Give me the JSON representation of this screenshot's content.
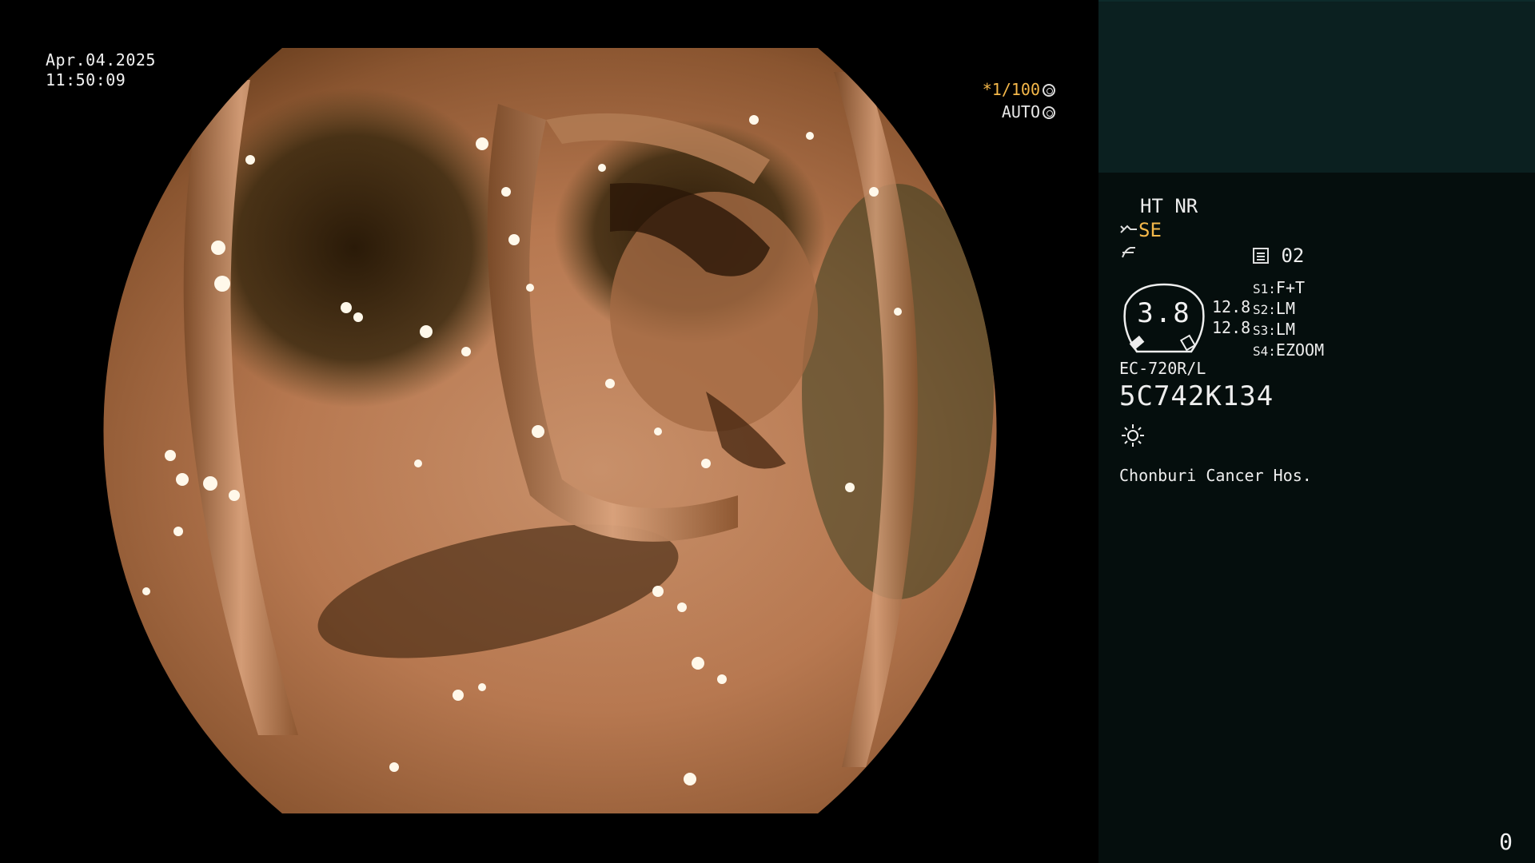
{
  "overlay": {
    "date": "Apr.04.2025",
    "time": "11:50:09",
    "shutter": "*1/100",
    "exposure": "AUTO"
  },
  "panel": {
    "mode_line": "HT NR",
    "se_label": "SE",
    "se_icon": "scope-tip-icon",
    "freeze_icon": "freeze-off-icon",
    "memory_label": "02",
    "zoom_value": "3.8",
    "gain_top": "12.8",
    "gain_bottom": "12.8",
    "switches": [
      {
        "key": "S1:",
        "value": "F+T"
      },
      {
        "key": "S2:",
        "value": "LM"
      },
      {
        "key": "S3:",
        "value": "LM"
      },
      {
        "key": "S4:",
        "value": "EZOOM"
      }
    ],
    "scope_model": "EC-720R/L",
    "scope_serial": "5C742K134",
    "light_icon": "sun-icon",
    "hospital": "Chonburi Cancer Hos.",
    "frame_number": "0"
  },
  "colors": {
    "accent": "#f5b84a",
    "panel_bg": "#050e0d",
    "panel_top_bg": "#0b2020"
  }
}
